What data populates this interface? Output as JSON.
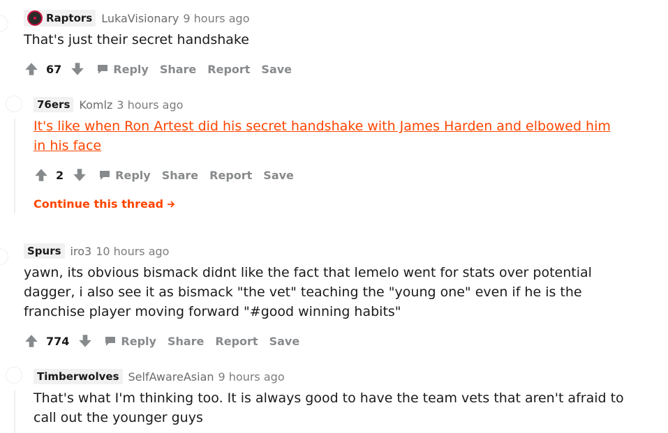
{
  "comments": [
    {
      "flair": "Raptors",
      "author": "LukaVisionary",
      "time": "9 hours ago",
      "body": "That's just their secret handshake",
      "votes": "67",
      "actions": {
        "reply": "Reply",
        "share": "Share",
        "report": "Report",
        "save": "Save"
      }
    },
    {
      "flair": "76ers",
      "author": "Komlz",
      "time": "3 hours ago",
      "body": "It's like when Ron Artest did his secret handshake with James Harden and elbowed him in his face",
      "votes": "2",
      "actions": {
        "reply": "Reply",
        "share": "Share",
        "report": "Report",
        "save": "Save"
      },
      "continue": "Continue this thread"
    },
    {
      "flair": "Spurs",
      "author": "iro3",
      "time": "10 hours ago",
      "body": "yawn, its obvious bismack didnt like the fact that lemelo went for stats over potential dagger, i also see it as bismack \"the vet\" teaching the \"young one\" even if he is the franchise player moving forward \"#good winning habits\"",
      "votes": "774",
      "actions": {
        "reply": "Reply",
        "share": "Share",
        "report": "Report",
        "save": "Save"
      }
    },
    {
      "flair": "Timberwolves",
      "author": "SelfAwareAsian",
      "time": "9 hours ago",
      "body": "That's what I'm thinking too. It is always good to have the team vets that aren't afraid to call out the younger guys"
    }
  ],
  "colors": {
    "link": "#ff4500",
    "muted": "#878a8c",
    "flair_bg": "#f1f1f1"
  },
  "icons": [
    "upvote-icon",
    "downvote-icon",
    "comment-icon",
    "arrow-right-icon",
    "raptors-logo-icon"
  ]
}
